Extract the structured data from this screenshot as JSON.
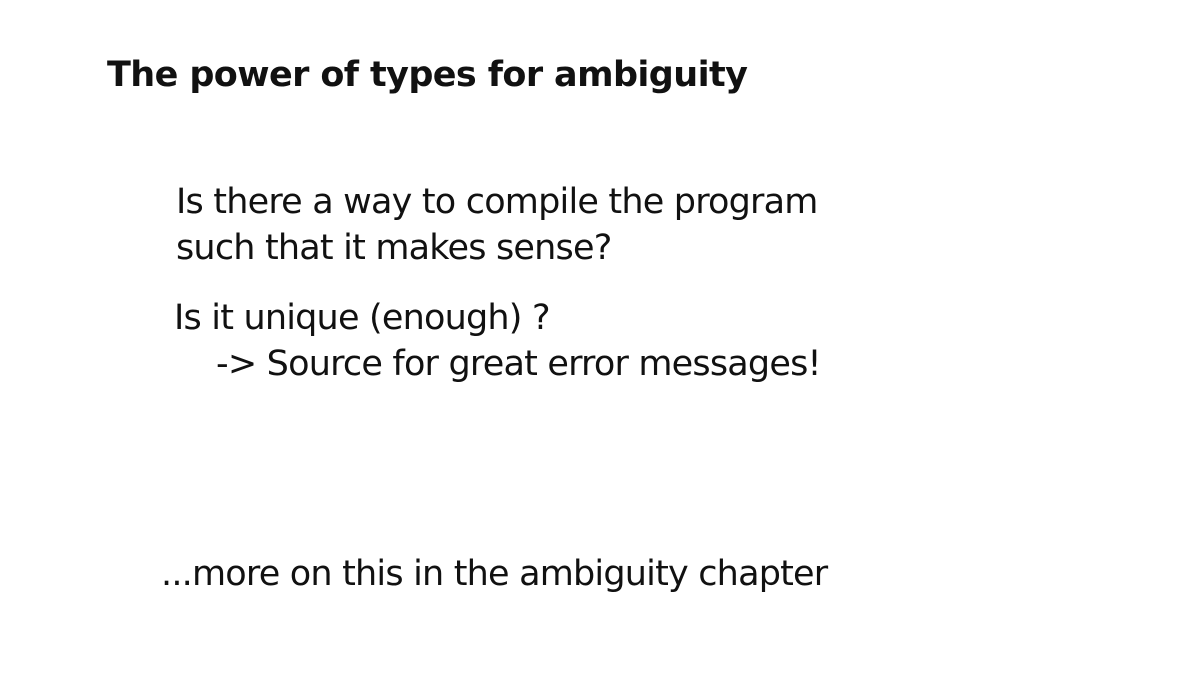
{
  "slide": {
    "title": "The power of types for ambiguity",
    "question1": {
      "line1": "Is there a way to compile the program",
      "line2": "such that it makes sense?"
    },
    "question2": {
      "line1": "Is it unique (enough) ?",
      "line2": "-> Source for great error messages!"
    },
    "footer": "...more on this in the ambiguity chapter"
  }
}
